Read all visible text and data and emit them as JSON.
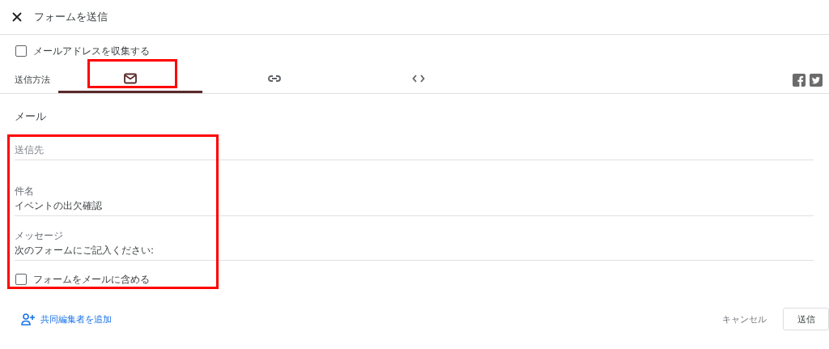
{
  "dialog": {
    "title": "フォームを送信"
  },
  "collect_emails": {
    "label": "メールアドレスを収集する",
    "checked": false
  },
  "send_via": {
    "label": "送信方法",
    "tabs": [
      {
        "kind": "email",
        "selected": true,
        "highlighted": true
      },
      {
        "kind": "link",
        "selected": false,
        "highlighted": false
      },
      {
        "kind": "embed",
        "selected": false,
        "highlighted": false
      }
    ]
  },
  "share": [
    {
      "kind": "facebook"
    },
    {
      "kind": "twitter"
    }
  ],
  "section": {
    "heading": "メール",
    "highlighted": true,
    "fields": [
      {
        "placeholder": "送信先"
      },
      {
        "label": "件名",
        "value": "イベントの出欠確認"
      },
      {
        "label": "メッセージ",
        "value": "次のフォームにご記入ください:"
      }
    ],
    "include_form": {
      "label": "フォームをメールに含める",
      "checked": false
    }
  },
  "footer": {
    "add_collaborators": "共同編集者を追加",
    "cancel": "キャンセル",
    "send": "送信"
  }
}
